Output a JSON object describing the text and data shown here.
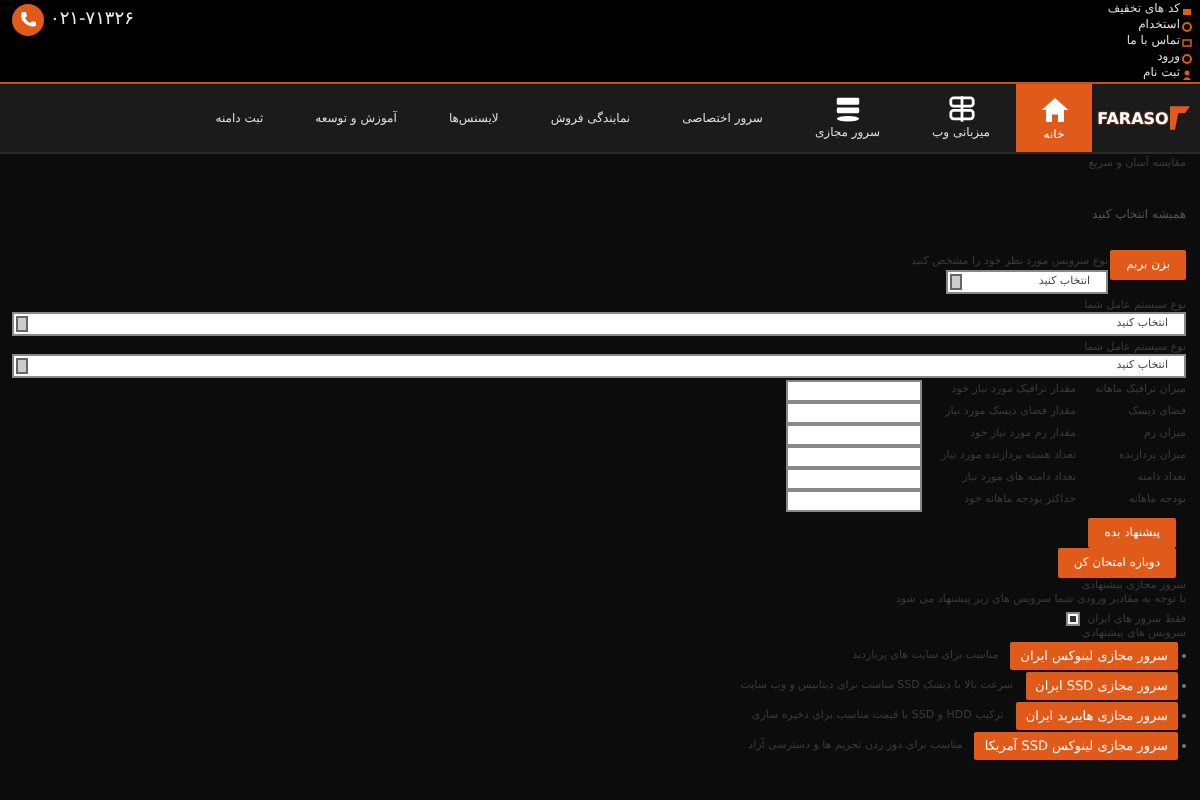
{
  "top_links": [
    {
      "label": "کد های تخفیف"
    },
    {
      "label": "استخدام"
    },
    {
      "label": "تماس با ما"
    },
    {
      "label": "ورود"
    },
    {
      "label": "ثبت نام"
    }
  ],
  "phone": "۰۲۱-۷۱۳۲۶",
  "logo": "FARASO",
  "nav": [
    {
      "label": "خانه",
      "selected": true
    },
    {
      "label": "میزبانی وب",
      "selected": false
    },
    {
      "label": "سرور مجازی",
      "selected": false
    },
    {
      "label": "سرور اختصاصی",
      "selected": false
    },
    {
      "label": "نمایندگی فروش",
      "selected": false
    },
    {
      "label": "لایسنس‌ها",
      "selected": false
    },
    {
      "label": "آموزش و توسعه",
      "selected": false
    },
    {
      "label": "ثبت دامنه",
      "selected": false
    }
  ],
  "breadcrumb": "مقایسه آسان و سریع",
  "heading": "همیشه انتخاب کنید",
  "start": {
    "button": "بزن بریم",
    "label": "نوع سرویس مورد نظر خود را مشخص کنید",
    "select": "انتخاب کنید"
  },
  "selects": [
    {
      "label": "نوع سیستم عامل شما",
      "value": "انتخاب کنید"
    },
    {
      "label": "نوع سیستم عامل شما",
      "value": "انتخاب کنید"
    }
  ],
  "fields": [
    {
      "label": "میزان ترافیک ماهانه",
      "hint": "مقدار ترافیک مورد نیاز خود"
    },
    {
      "label": "فضای دیسک",
      "hint": "مقدار فضای دیسک مورد نیاز"
    },
    {
      "label": "میزان رم",
      "hint": "مقدار رم مورد نیاز خود"
    },
    {
      "label": "میزان پردازنده",
      "hint": "تعداد هسته پردازنده مورد نیاز"
    },
    {
      "label": "تعداد دامنه",
      "hint": "تعداد دامنه های مورد نیاز"
    },
    {
      "label": "بودجه ماهانه",
      "hint": "حداکثر بودجه ماهانه خود"
    }
  ],
  "actions": [
    "پیشنهاد بده",
    "دوباره امتحان کن"
  ],
  "notes": [
    "سرور مجازی پیشنهادی",
    "با توجه به مقادیر ورودی شما سرویس های زیر پیشنهاد می شود"
  ],
  "filter": {
    "label": "فقط سرور های ایران",
    "checked": true,
    "caption": "سرویس های پیشنهادی"
  },
  "results": [
    {
      "button": "سرور مجازی لینوکس ایران",
      "description": "مناسب برای سایت های پربازدید"
    },
    {
      "button": "سرور مجازی SSD ایران",
      "description": "سرعت بالا با دیسک SSD مناسب برای دیتابیس و وب سایت"
    },
    {
      "button": "سرور مجازی هایبرید ایران",
      "description": "ترکیب HDD و SSD با قیمت مناسب برای ذخیره سازی"
    },
    {
      "button": "سرور مجازی لینوکس SSD آمریکا",
      "description": "مناسب برای دور زدن تحریم ها و دسترسی آزاد"
    }
  ]
}
